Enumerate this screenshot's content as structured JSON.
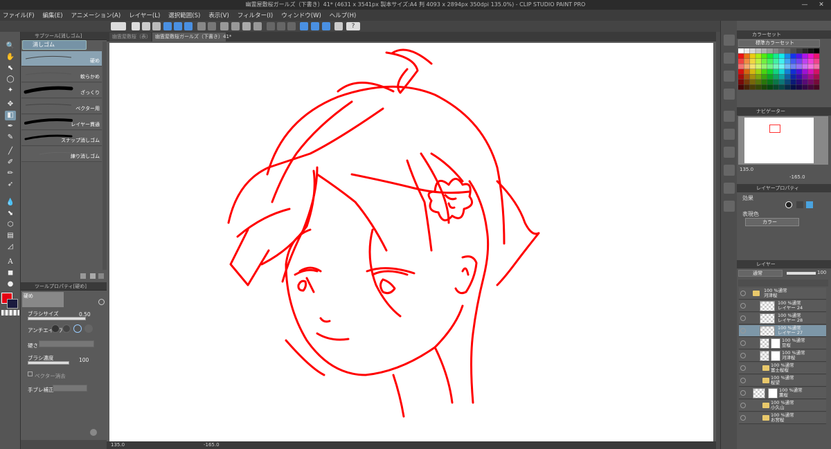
{
  "window": {
    "title": "幽霊屋敷桜ガールズ（下書き）41* (4631 x 3541px 製本サイズ:A4 判 4093 x 2894px 350dpi 135.0%) - CLIP STUDIO PAINT PRO",
    "min_icon": "minimize-icon",
    "close_icon": "close-icon"
  },
  "menu": [
    "ファイル(F)",
    "編集(E)",
    "アニメーション(A)",
    "レイヤー(L)",
    "選択範囲(S)",
    "表示(V)",
    "フィルター(I)",
    "ウィンドウ(W)",
    "ヘルプ(H)"
  ],
  "tabs": [
    {
      "label": "幽霊屋敷桜（表）"
    },
    {
      "label": "幽霊屋敷桜ガールズ（下書き）41*"
    }
  ],
  "subtool": {
    "header": "サブツール[消しゴム]",
    "group": "消しゴム",
    "brushes": [
      "硬め",
      "軟らかめ",
      "ざっくり",
      "ベクター用",
      "レイヤー貫通",
      "スナップ消しゴム",
      "練り消しゴム"
    ],
    "selected_index": 0
  },
  "toolprop": {
    "header": "ツールプロパティ[硬め]",
    "brush_name": "硬め",
    "brush_size_label": "ブラシサイズ",
    "brush_size_value": "0.50",
    "antialias_label": "アンチエイリアス",
    "hardness_label": "硬さ",
    "density_label": "ブラシ濃度",
    "density_value": "100",
    "vector_erase_label": "ベクター消去",
    "stabilize_label": "手ブレ補正"
  },
  "colors": {
    "main": "#e60012",
    "sub": "#1a1a3e",
    "line_art": "#ff0000"
  },
  "status": {
    "zoom": "135.0",
    "angle": "-165.0"
  },
  "colorset": {
    "header": "カラーセット",
    "preset": "標準カラーセット"
  },
  "navigator": {
    "header": "ナビゲーター",
    "zoom": "135.0",
    "angle": "-165.0"
  },
  "layer_property": {
    "header": "レイヤープロパティ",
    "effect_label": "効果",
    "expression_label": "表現色",
    "expression_value": "カラー"
  },
  "layer_panel": {
    "header": "レイヤー",
    "blend_mode": "通常",
    "opacity": "100",
    "layers": [
      {
        "mode": "100 %通常",
        "name": "河津桜",
        "type": "folder",
        "selected": false,
        "sub": false
      },
      {
        "mode": "100 %通常",
        "name": "レイヤー 24",
        "type": "raster",
        "selected": false,
        "sub": true
      },
      {
        "mode": "100 %通常",
        "name": "レイヤー 28",
        "type": "raster",
        "selected": false,
        "sub": true
      },
      {
        "mode": "100 %通常",
        "name": "レイヤー 27",
        "type": "raster",
        "selected": true,
        "sub": true
      },
      {
        "mode": "100 %通常",
        "name": "豆桜",
        "type": "raster-mask",
        "selected": false,
        "sub": true
      },
      {
        "mode": "100 %通常",
        "name": "河津桜",
        "type": "raster-mask",
        "selected": false,
        "sub": true
      },
      {
        "mode": "100 %通常",
        "name": "富士桜桜",
        "type": "folder",
        "selected": false,
        "sub": false
      },
      {
        "mode": "100 %通常",
        "name": "桜望",
        "type": "folder",
        "selected": false,
        "sub": false
      },
      {
        "mode": "100 %通常",
        "name": "薫桜",
        "type": "raster-mask",
        "selected": false,
        "sub": false
      },
      {
        "mode": "100 %通常",
        "name": "小久山",
        "type": "folder",
        "selected": false,
        "sub": false
      },
      {
        "mode": "100 %通常",
        "name": "お宮桜",
        "type": "folder",
        "selected": false,
        "sub": false
      }
    ]
  }
}
